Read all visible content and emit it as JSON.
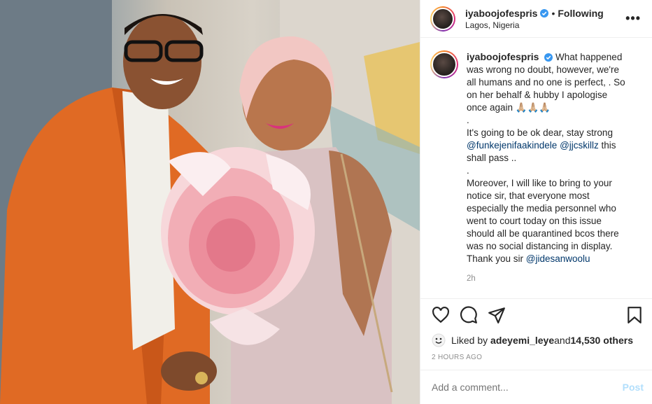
{
  "post": {
    "username": "iyaboojofespris",
    "follow_status": "Following",
    "location": "Lagos, Nigeria",
    "more_icon": "more-options-icon"
  },
  "caption": {
    "username": "iyaboojofespris",
    "line1": "What happened was wrong no doubt, however, we're all humans and no one is perfect, . So on her behalf & hubby I apologise once again 🙏🏼🙏🏼🙏🏼",
    "line2": ".",
    "line3": "It's going to be ok dear, stay strong ",
    "mention1": "@funkejenifaakindele",
    "mention2": "@jjcskillz",
    "line3_end": " this shall pass ..",
    "line4": ".",
    "line5": "Moreover, I will like to bring to your notice sir, that everyone most especially the media personnel who went to court today on this issue should all be quarantined bcos there was no social distancing in display. Thank you sir ",
    "mention3": "@jidesanwoolu",
    "time": "2h"
  },
  "actions": {
    "like_icon": "heart-icon",
    "comment_icon": "comment-icon",
    "share_icon": "share-icon",
    "save_icon": "bookmark-icon"
  },
  "likes": {
    "prefix": "Liked by ",
    "user": "adeyemi_leye",
    "and": " and ",
    "count": "14,530 others"
  },
  "posted_ago": "2 HOURS AGO",
  "comment": {
    "placeholder": "Add a comment...",
    "post_label": "Post"
  },
  "colors": {
    "verified": "#3897f0",
    "mention": "#00376b",
    "post_disabled": "#b2dffc"
  }
}
